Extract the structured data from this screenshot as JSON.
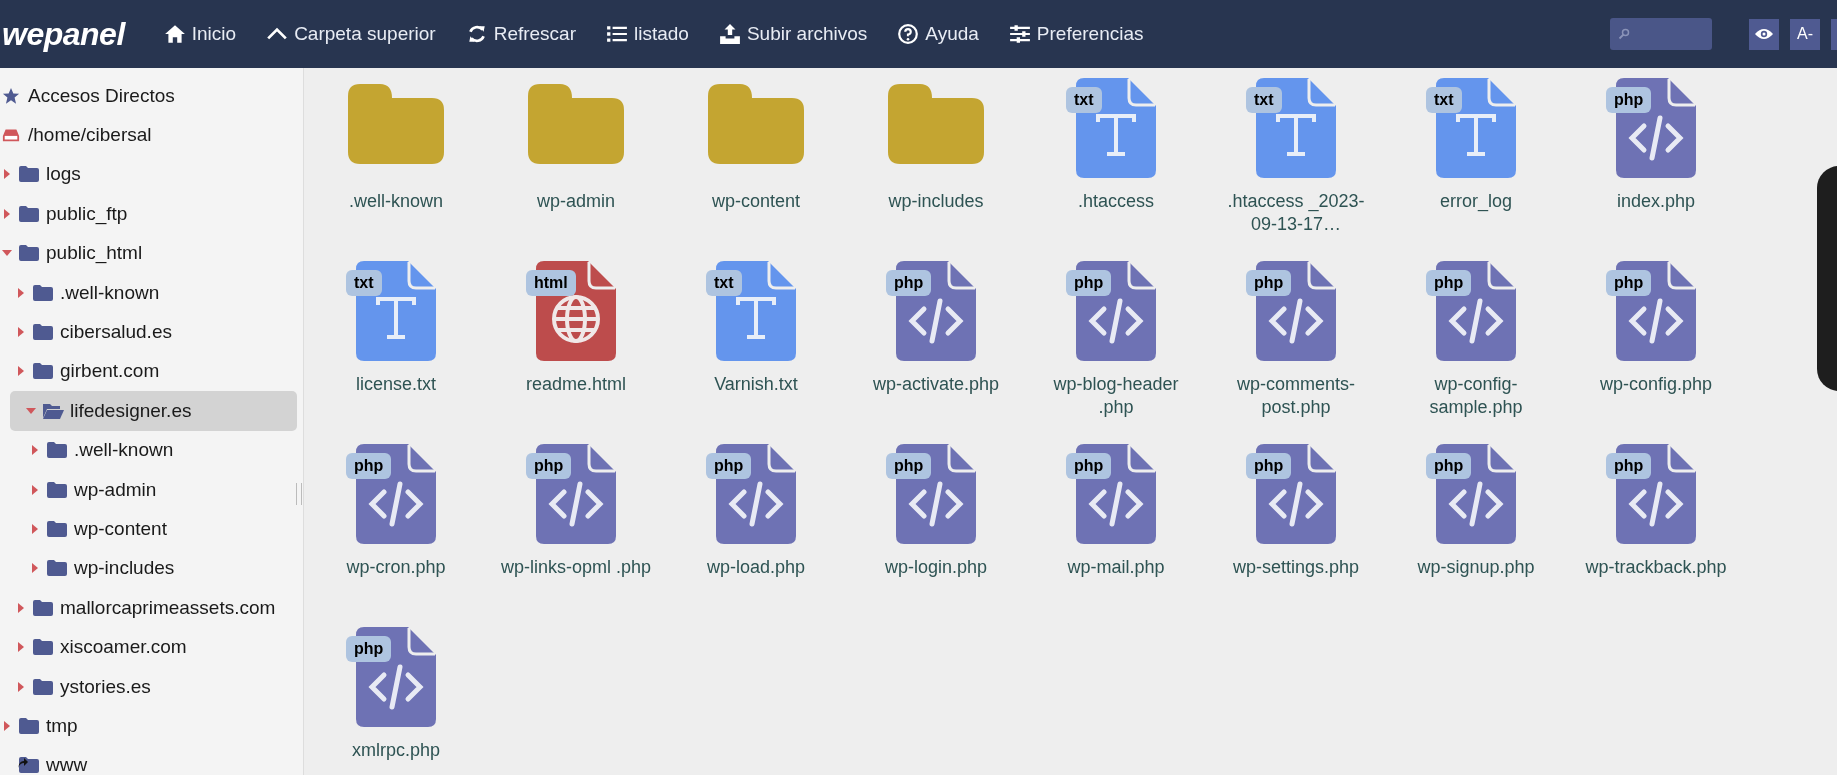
{
  "logo": "wepanel",
  "toolbar": [
    {
      "label": "Inicio",
      "kind": "home"
    },
    {
      "label": "Carpeta superior",
      "kind": "up"
    },
    {
      "label": "Refrescar",
      "kind": "refresh"
    },
    {
      "label": "listado",
      "kind": "list"
    },
    {
      "label": "Subir archivos",
      "kind": "upload"
    },
    {
      "label": "Ayuda",
      "kind": "help"
    },
    {
      "label": "Preferencias",
      "kind": "settings"
    }
  ],
  "top_right_buttons": [
    {
      "kind": "eye"
    },
    {
      "label": "A-",
      "kind": "text"
    }
  ],
  "tree": [
    {
      "label": "Accesos Directos",
      "kind": "star"
    },
    {
      "label": "/home/cibersal",
      "kind": "drive",
      "children": [
        {
          "label": "logs",
          "kind": "folder",
          "expanded": false,
          "selected": false
        },
        {
          "label": "public_ftp",
          "kind": "folder",
          "expanded": false,
          "selected": false
        },
        {
          "label": "public_html",
          "kind": "folder",
          "expanded": true,
          "selected": false,
          "children": [
            {
              "label": ".well-known",
              "kind": "folder",
              "expanded": false,
              "selected": false
            },
            {
              "label": "cibersalud.es",
              "kind": "folder",
              "expanded": false,
              "selected": false
            },
            {
              "label": "girbent.com",
              "kind": "folder",
              "expanded": false,
              "selected": false
            },
            {
              "label": "lifedesigner.es",
              "kind": "folder",
              "expanded": true,
              "selected": true,
              "children": [
                {
                  "label": ".well-known",
                  "kind": "folder",
                  "expanded": false,
                  "selected": false
                },
                {
                  "label": "wp-admin",
                  "kind": "folder",
                  "expanded": false,
                  "selected": false
                },
                {
                  "label": "wp-content",
                  "kind": "folder",
                  "expanded": false,
                  "selected": false
                },
                {
                  "label": "wp-includes",
                  "kind": "folder",
                  "expanded": false,
                  "selected": false
                }
              ]
            },
            {
              "label": "mallorcaprimeassets.com",
              "kind": "folder",
              "expanded": false,
              "selected": false
            },
            {
              "label": "xiscoamer.com",
              "kind": "folder",
              "expanded": false,
              "selected": false
            },
            {
              "label": "ystories.es",
              "kind": "folder",
              "expanded": false,
              "selected": false
            }
          ]
        },
        {
          "label": "tmp",
          "kind": "folder",
          "expanded": false,
          "selected": false
        },
        {
          "label": "www",
          "kind": "link",
          "selected": false
        }
      ]
    }
  ],
  "files": [
    {
      "name": ".well-known",
      "kind": "folder"
    },
    {
      "name": "wp-admin",
      "kind": "folder"
    },
    {
      "name": "wp-content",
      "kind": "folder"
    },
    {
      "name": "wp-includes",
      "kind": "folder"
    },
    {
      "name": ".htaccess",
      "kind": "txt",
      "badge": "txt"
    },
    {
      "name": ".htaccess _2023-09-13-17…",
      "kind": "txt",
      "badge": "txt"
    },
    {
      "name": "error_log",
      "kind": "txt",
      "badge": "txt"
    },
    {
      "name": "index.php",
      "kind": "php",
      "badge": "php"
    },
    {
      "name": "license.txt",
      "kind": "txt",
      "badge": "txt"
    },
    {
      "name": "readme.html",
      "kind": "html",
      "badge": "html"
    },
    {
      "name": "Varnish.txt",
      "kind": "txt",
      "badge": "txt"
    },
    {
      "name": "wp-activate.php",
      "kind": "php",
      "badge": "php"
    },
    {
      "name": "wp-blog-header .php",
      "kind": "php",
      "badge": "php"
    },
    {
      "name": "wp-comments-post.php",
      "kind": "php",
      "badge": "php"
    },
    {
      "name": "wp-config-sample.php",
      "kind": "php",
      "badge": "php"
    },
    {
      "name": "wp-config.php",
      "kind": "php",
      "badge": "php"
    },
    {
      "name": "wp-cron.php",
      "kind": "php",
      "badge": "php"
    },
    {
      "name": "wp-links-opml .php",
      "kind": "php",
      "badge": "php"
    },
    {
      "name": "wp-load.php",
      "kind": "php",
      "badge": "php"
    },
    {
      "name": "wp-login.php",
      "kind": "php",
      "badge": "php"
    },
    {
      "name": "wp-mail.php",
      "kind": "php",
      "badge": "php"
    },
    {
      "name": "wp-settings.php",
      "kind": "php",
      "badge": "php"
    },
    {
      "name": "wp-signup.php",
      "kind": "php",
      "badge": "php"
    },
    {
      "name": "wp-trackback.php",
      "kind": "php",
      "badge": "php"
    },
    {
      "name": "xmlrpc.php",
      "kind": "php",
      "badge": "php"
    }
  ]
}
